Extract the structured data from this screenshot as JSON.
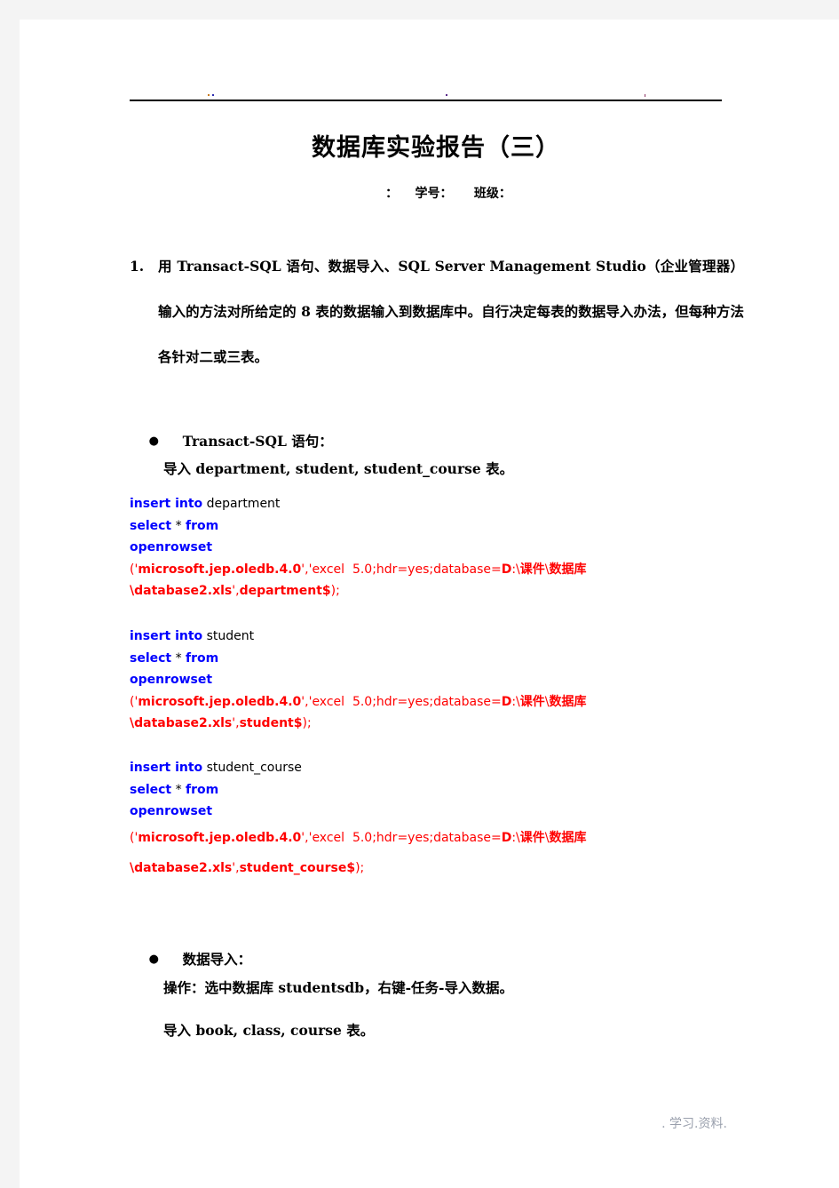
{
  "document": {
    "title": "数据库实验报告（三）",
    "subtitle": "：    学号：     班级：",
    "footer": ". 学习.资料."
  },
  "header": {
    "rule": "horizontal-rule"
  },
  "items": [
    {
      "marker": "1.",
      "text": "用 Transact-SQL 语句、数据导入、SQL Server Management Studio（企业管理器）输入的方法对所给定的 8 表的数据输入到数据库中。自行决定每表的数据导入办法，但每种方法各针对二或三表。"
    }
  ],
  "bullets": [
    {
      "marker": "●",
      "label": "Transact-SQL 语句："
    },
    {
      "marker": "●",
      "label": "数据导入："
    }
  ],
  "sub_lines": {
    "import_tsql": "导入 department, student, student_course 表。",
    "operation": "操作：选中数据库 studentsdb，右键-任务-导入数据。",
    "import_wizard": "导入 book, class, course 表。"
  },
  "code_blocks": [
    {
      "name": "department",
      "lines": [
        {
          "kw": "insert into",
          "id": " department"
        },
        {
          "kw": "select",
          "id": " * ",
          "kw2": "from"
        },
        {
          "kw": "openrowset"
        },
        {
          "str_open": "('",
          "strb1": "microsoft.jep.oledb.4.0",
          "str_mid": "','",
          "str_rest": "excel  5.0;hdr=yes;database=",
          "strb2": "D",
          "str_tail": ":\\",
          "cjk": "课件",
          "str_tail2": "\\",
          "cjk2": "数据库"
        },
        {
          "strb3": "\\database2.xls",
          "str_q": "',",
          "strb4": "department$",
          "str_end": ");"
        }
      ]
    },
    {
      "name": "student",
      "lines": [
        {
          "kw": "insert into",
          "id": " student"
        },
        {
          "kw": "select",
          "id": " * ",
          "kw2": "from"
        },
        {
          "kw": "openrowset"
        },
        {
          "str_open": "('",
          "strb1": "microsoft.jep.oledb.4.0",
          "str_mid": "','",
          "str_rest": "excel  5.0;hdr=yes;database=",
          "strb2": "D",
          "str_tail": ":\\",
          "cjk": "课件",
          "str_tail2": "\\",
          "cjk2": "数据库"
        },
        {
          "strb3": "\\database2.xls",
          "str_q": "',",
          "strb4": "student$",
          "str_end": ");"
        }
      ]
    },
    {
      "name": "student_course",
      "lines": [
        {
          "kw": "insert into",
          "id": " student_course"
        },
        {
          "kw": "select",
          "id": " * ",
          "kw2": "from"
        },
        {
          "kw": "openrowset"
        },
        {
          "str_open": "('",
          "strb1": "microsoft.jep.oledb.4.0",
          "str_mid": "','",
          "str_rest": "excel  5.0;hdr=yes;database=",
          "strb2": "D",
          "str_tail": ":\\",
          "cjk": "课件",
          "str_tail2": "\\",
          "cjk2": "数据库"
        },
        {
          "strb3": "\\database2.xls",
          "str_q": "',",
          "strb4": "student_course$",
          "str_end": ");"
        }
      ]
    }
  ],
  "colors": {
    "keyword": "#0000ff",
    "string": "#ff0000",
    "identifier": "#000000",
    "page_background": "#ffffff",
    "canvas_background": "#f4f4f4",
    "footer_text": "#9aa0ad"
  }
}
